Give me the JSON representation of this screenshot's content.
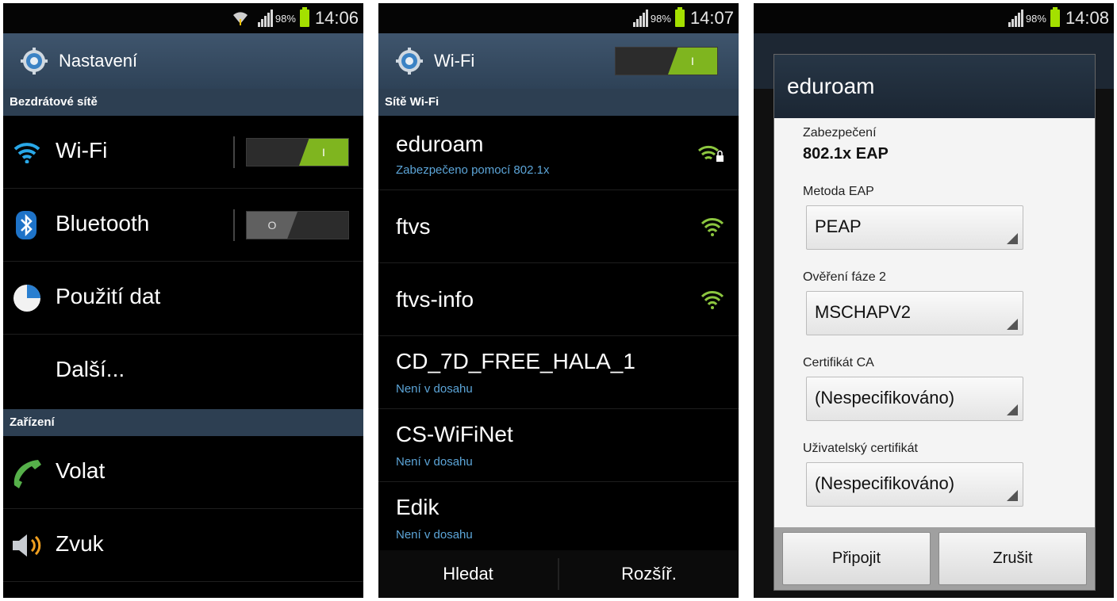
{
  "screen1": {
    "status": {
      "battery": "98%",
      "time": "14:06"
    },
    "title": "Nastavení",
    "section_wireless": "Bezdrátové sítě",
    "wifi_label": "Wi-Fi",
    "wifi_toggle": "I",
    "bluetooth_label": "Bluetooth",
    "bluetooth_toggle": "O",
    "data_usage_label": "Použití dat",
    "more_label": "Další...",
    "section_device": "Zařízení",
    "call_label": "Volat",
    "sound_label": "Zvuk"
  },
  "screen2": {
    "status": {
      "battery": "98%",
      "time": "14:07"
    },
    "title": "Wi-Fi",
    "wifi_toggle": "I",
    "section": "Sítě Wi-Fi",
    "networks": [
      {
        "name": "eduroam",
        "sub": "Zabezpečeno pomocí 802.1x"
      },
      {
        "name": "ftvs",
        "sub": ""
      },
      {
        "name": "ftvs-info",
        "sub": ""
      },
      {
        "name": "CD_7D_FREE_HALA_1",
        "sub": "Není v dosahu"
      },
      {
        "name": "CS-WiFiNet",
        "sub": "Není v dosahu"
      },
      {
        "name": "Edik",
        "sub": "Není v dosahu"
      }
    ],
    "scan_label": "Hledat",
    "advanced_label": "Rozšíř."
  },
  "screen3": {
    "status": {
      "battery": "98%",
      "time": "14:08"
    },
    "dialog": {
      "title": "eduroam",
      "security_label": "Zabezpečení",
      "security_value": "802.1x EAP",
      "eap_label": "Metoda EAP",
      "eap_value": "PEAP",
      "phase2_label": "Ověření fáze 2",
      "phase2_value": "MSCHAPV2",
      "ca_label": "Certifikát CA",
      "ca_value": "(Nespecifikováno)",
      "user_cert_label": "Uživatelský certifikát",
      "user_cert_value": "(Nespecifikováno)",
      "connect_label": "Připojit",
      "cancel_label": "Zrušit"
    }
  },
  "colors": {
    "accent_green": "#7fb51f",
    "title_bar": "#3f556d",
    "section_bar": "#2d3f52",
    "link_blue": "#5ca5d8"
  }
}
